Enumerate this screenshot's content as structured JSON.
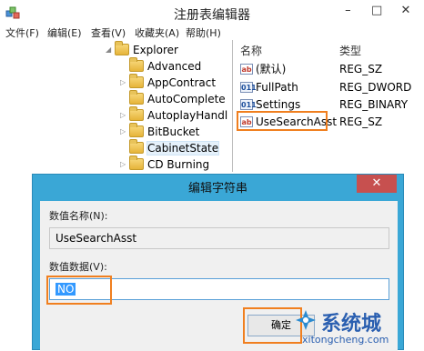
{
  "window": {
    "title": "注册表编辑器",
    "controls": [
      "–",
      "□",
      "✕"
    ]
  },
  "menu": [
    "文件(F)",
    "编辑(E)",
    "查看(V)",
    "收藏夹(A)",
    "帮助(H)"
  ],
  "tree": {
    "root": "Explorer",
    "items": [
      "Advanced",
      "AppContract",
      "AutoComplete",
      "AutoplayHandl",
      "BitBucket",
      "CabinetState",
      "CD Burning"
    ],
    "selected": "CabinetState"
  },
  "list": {
    "headers": {
      "name": "名称",
      "type": "类型"
    },
    "rows": [
      {
        "icon": "ab",
        "name": "(默认)",
        "type": "REG_SZ"
      },
      {
        "icon": "011",
        "name": "FullPath",
        "type": "REG_DWORD"
      },
      {
        "icon": "011",
        "name": "Settings",
        "type": "REG_BINARY"
      },
      {
        "icon": "ab",
        "name": "UseSearchAsst",
        "type": "REG_SZ"
      }
    ]
  },
  "dialog": {
    "title": "编辑字符串",
    "close_label": "✕",
    "name_label": "数值名称(N):",
    "name_value": "UseSearchAsst",
    "data_label": "数值数据(V):",
    "data_value": "NO",
    "ok_label": "确定"
  },
  "watermark": {
    "text": "系统城",
    "url": "xitongcheng.com"
  },
  "colors": {
    "dialog_frame": "#3aa7d6",
    "highlight_orange": "#f07f1f",
    "selection_blue": "#3399ff"
  }
}
